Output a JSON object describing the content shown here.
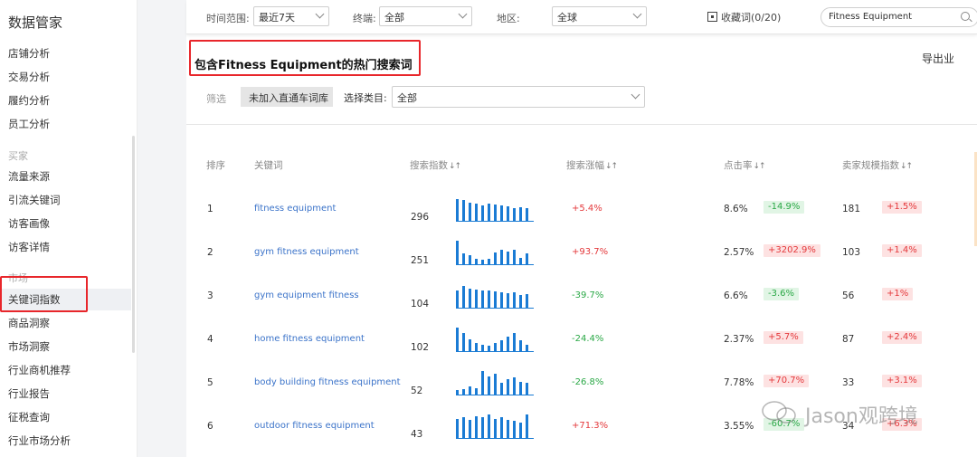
{
  "sidebar": {
    "title": "数据管家",
    "items_top": [
      "店铺分析",
      "交易分析",
      "履约分析",
      "员工分析"
    ],
    "group_buyer": "买家",
    "items_buyer": [
      "流量来源",
      "引流关键词",
      "访客画像",
      "访客详情"
    ],
    "group_market": "市场",
    "items_market": [
      "关键词指数",
      "商品洞察",
      "市场洞察",
      "行业商机推荐",
      "行业报告",
      "征税查询",
      "行业市场分析"
    ]
  },
  "filters": {
    "time_label": "时间范围:",
    "time_value": "最近7天",
    "device_label": "终端:",
    "device_value": "全部",
    "region_label": "地区:",
    "region_value": "全球",
    "favorites": "收藏词(0/20)",
    "search_value": "Fitness Equipment"
  },
  "page": {
    "title": "包含Fitness Equipment的热门搜索词",
    "export": "导出业"
  },
  "subfilter": {
    "sift_label": "筛选",
    "chip": "未加入直通车词库",
    "category_label": "选择类目:",
    "category_value": "全部"
  },
  "table": {
    "headers": {
      "rank": "排序",
      "keyword": "关键词",
      "search_index": "搜索指数",
      "growth": "搜索涨幅",
      "ctr": "点击率",
      "seller": "卖家规模指数"
    },
    "sort_icon": "↓↑",
    "rows": [
      {
        "rank": "1",
        "keyword": "fitness equipment",
        "index": "296",
        "growth": "+5.4%",
        "growth_dir": "up",
        "ctr": "8.6%",
        "ctr_change": "-14.9%",
        "ctr_dir": "down",
        "seller": "181",
        "seller_change": "+1.5%",
        "seller_dir": "up",
        "trend": [
          0.9,
          0.85,
          0.75,
          0.72,
          0.65,
          0.72,
          0.68,
          0.65,
          0.6,
          0.55,
          0.58,
          0.55
        ]
      },
      {
        "rank": "2",
        "keyword": "gym fitness equipment",
        "index": "251",
        "growth": "+93.7%",
        "growth_dir": "up",
        "ctr": "2.57%",
        "ctr_change": "+3202.9%",
        "ctr_dir": "up",
        "seller": "103",
        "seller_change": "+1.4%",
        "seller_dir": "up",
        "trend": [
          0.95,
          0.45,
          0.4,
          0.25,
          0.2,
          0.25,
          0.5,
          0.6,
          0.55,
          0.6,
          0.3,
          0.45
        ]
      },
      {
        "rank": "3",
        "keyword": "gym equipment fitness",
        "index": "104",
        "growth": "-39.7%",
        "growth_dir": "down",
        "ctr": "6.6%",
        "ctr_change": "-3.6%",
        "ctr_dir": "down",
        "seller": "56",
        "seller_change": "+1%",
        "seller_dir": "up",
        "trend": [
          0.7,
          0.9,
          0.8,
          0.75,
          0.72,
          0.7,
          0.68,
          0.65,
          0.6,
          0.65,
          0.55,
          0.58
        ]
      },
      {
        "rank": "4",
        "keyword": "home fitness equipment",
        "index": "102",
        "growth": "-24.4%",
        "growth_dir": "down",
        "ctr": "2.37%",
        "ctr_change": "+5.7%",
        "ctr_dir": "up",
        "seller": "87",
        "seller_change": "+2.4%",
        "seller_dir": "up",
        "trend": [
          0.95,
          0.75,
          0.5,
          0.35,
          0.3,
          0.25,
          0.35,
          0.45,
          0.6,
          0.75,
          0.45,
          0.3
        ]
      },
      {
        "rank": "5",
        "keyword": "body building fitness equipment",
        "index": "52",
        "growth": "-26.8%",
        "growth_dir": "down",
        "ctr": "7.78%",
        "ctr_change": "+70.7%",
        "ctr_dir": "up",
        "seller": "33",
        "seller_change": "+3.1%",
        "seller_dir": "up",
        "trend": [
          0.2,
          0.25,
          0.35,
          0.3,
          0.95,
          0.75,
          0.85,
          0.5,
          0.65,
          0.7,
          0.55,
          0.5
        ]
      },
      {
        "rank": "6",
        "keyword": "outdoor fitness equipment",
        "index": "43",
        "growth": "+71.3%",
        "growth_dir": "up",
        "ctr": "3.55%",
        "ctr_change": "-60.7%",
        "ctr_dir": "down",
        "seller": "34",
        "seller_change": "+6.3%",
        "seller_dir": "up",
        "trend": [
          0.8,
          0.85,
          0.75,
          0.9,
          0.85,
          0.95,
          0.8,
          0.85,
          0.75,
          0.7,
          0.65,
          0.95
        ]
      }
    ]
  },
  "colors": {
    "accent": "#1a7bd4",
    "highlight_box": "#e8262b",
    "positive": "#e4393c",
    "negative": "#2aa846"
  },
  "watermark": "Jason观跨境"
}
